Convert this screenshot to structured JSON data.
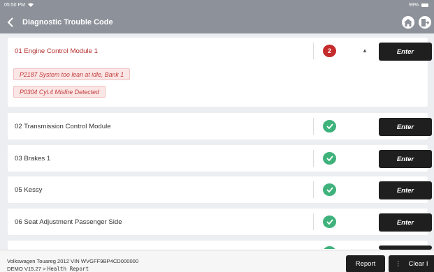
{
  "status_bar": {
    "time": "05:50 PM",
    "battery": "99%"
  },
  "header": {
    "title": "Diagnostic Trouble Code"
  },
  "modules": [
    {
      "name": "01 Engine Control Module 1",
      "fault_count": "2",
      "codes": [
        "P2187 System too lean at idle, Bank 1",
        "P0304 Cyl.4 Misfire Detected"
      ],
      "enter_label": "Enter"
    },
    {
      "name": "02 Transmission Control Module",
      "enter_label": "Enter"
    },
    {
      "name": "03 Brakes 1",
      "enter_label": "Enter"
    },
    {
      "name": "05 Kessy",
      "enter_label": "Enter"
    },
    {
      "name": "06 Seat Adjustment Passenger Side",
      "enter_label": "Enter"
    }
  ],
  "footer": {
    "vehicle": "Volkswagen  Touareg  2012  VIN  WVGFF9BP4CD000000",
    "version": "DEMO V15.27 >",
    "path": "Health Report",
    "report_label": "Report",
    "clear_label": "Clear I"
  },
  "colors": {
    "accent": "#b62c2c",
    "ok": "#3fb27c",
    "header": "#8d929a"
  }
}
